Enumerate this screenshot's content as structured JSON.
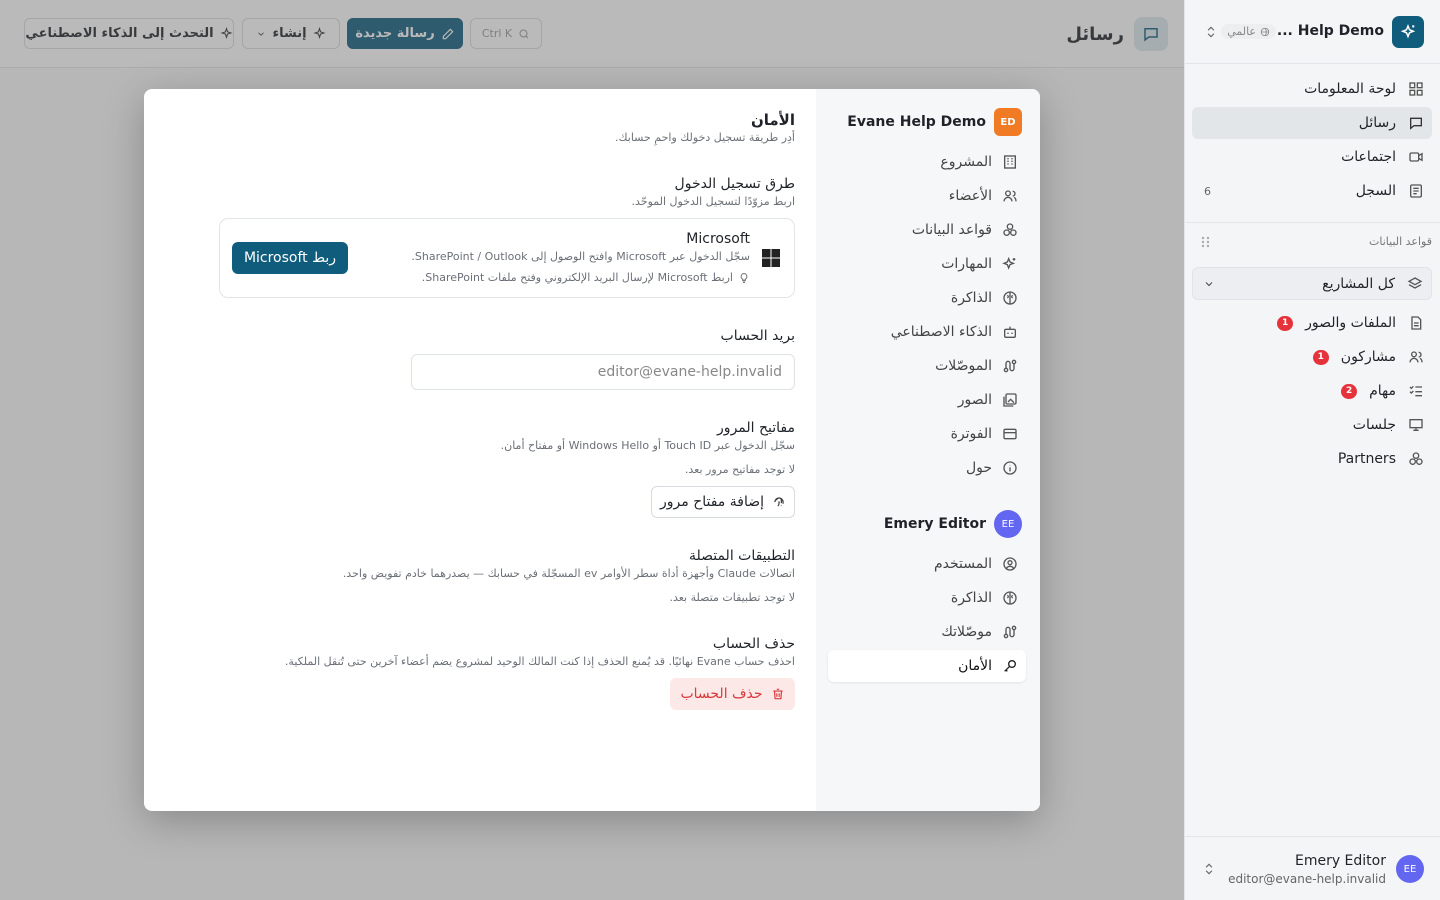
{
  "sidebar": {
    "workspace_name": "Help Demo ...",
    "workspace_scope": "عالمي",
    "nav": [
      {
        "label": "لوحة المعلومات"
      },
      {
        "label": "رسائل"
      },
      {
        "label": "اجتماعات"
      },
      {
        "label": "السجل",
        "count": "6"
      }
    ],
    "databases_title": "قواعد البيانات",
    "project_selector": "كل المشاريع",
    "db_items": [
      {
        "label": "الملفات والصور",
        "badge": "1"
      },
      {
        "label": "مشاركون",
        "badge": "1"
      },
      {
        "label": "مهام",
        "badge": "2"
      },
      {
        "label": "جلسات"
      },
      {
        "label": "Partners"
      }
    ],
    "user": {
      "name": "Emery Editor",
      "email": "editor@evane-help.invalid",
      "initials": "EE"
    }
  },
  "topbar": {
    "title": "رسائل",
    "search_shortcut": "Ctrl K",
    "new_message": "رسالة جديدة",
    "create": "إنشاء",
    "talk_ai": "التحدث إلى الذكاء الاصطناعي"
  },
  "modal": {
    "org_group": {
      "name": "Evane Help Demo",
      "initials": "ED"
    },
    "org_items": [
      "المشروع",
      "الأعضاء",
      "قواعد البيانات",
      "المهارات",
      "الذاكرة",
      "الذكاء الاصطناعي",
      "الموصّلات",
      "الصور",
      "الفوترة",
      "حول"
    ],
    "user_group": {
      "name": "Emery Editor",
      "initials": "EE"
    },
    "user_items": [
      "المستخدم",
      "الذاكرة",
      "موصّلاتك",
      "الأمان"
    ],
    "security": {
      "title": "الأمان",
      "subtitle": "أدِر طريقة تسجيل دخولك واحمِ حسابك.",
      "signin_title": "طرق تسجيل الدخول",
      "signin_sub": "اربط مزوّدًا لتسجيل الدخول الموحّد.",
      "ms_name": "Microsoft",
      "ms_desc": "سجّل الدخول عبر Microsoft وافتح الوصول إلى SharePoint / Outlook.",
      "ms_tip": "اربط Microsoft لإرسال البريد الإلكتروني وفتح ملفات SharePoint.",
      "ms_button": "ربط Microsoft",
      "email_title": "بريد الحساب",
      "email_value": "editor@evane-help.invalid",
      "passkeys_title": "مفاتيح المرور",
      "passkeys_sub": "سجّل الدخول عبر Touch ID أو Windows Hello أو مفتاح أمان.",
      "passkeys_empty": "لا توجد مفاتيح مرور بعد.",
      "passkeys_button": "إضافة مفتاح مرور",
      "apps_title": "التطبيقات المتصلة",
      "apps_sub": "اتصالات Claude وأجهزة أداة سطر الأوامر ev المسجّلة في حسابك — يصدرهما خادم تفويض واحد.",
      "apps_empty": "لا توجد تطبيقات متصلة بعد.",
      "delete_title": "حذف الحساب",
      "delete_sub": "احذف حساب Evane نهائيًا. قد يُمنع الحذف إذا كنت المالك الوحيد لمشروع يضم أعضاء آخرين حتى تُنقل الملكية.",
      "delete_button": "حذف الحساب"
    }
  },
  "colors": {
    "brand": "#0f5c7c",
    "danger": "#d8393d",
    "badge": "#e5323b",
    "avatar": "#6366f1",
    "org_avatar": "#f07b24"
  }
}
